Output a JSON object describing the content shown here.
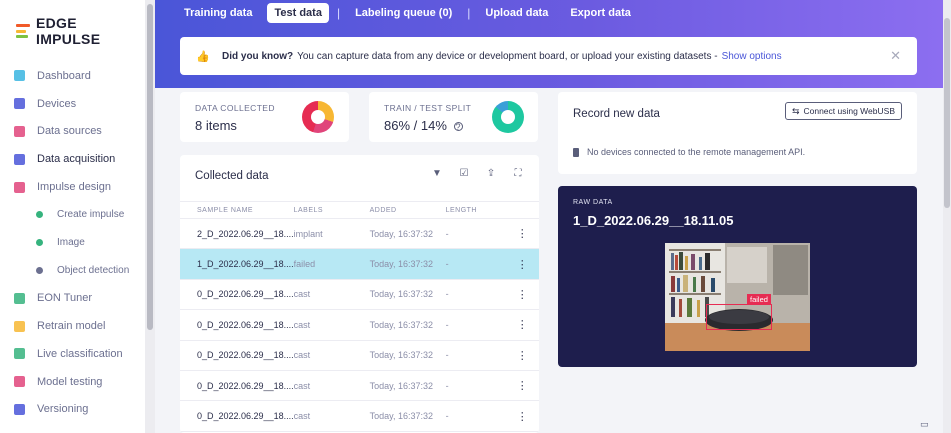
{
  "brand": {
    "name": "EDGE IMPULSE",
    "colors": [
      "#f15a29",
      "#f7b733",
      "#7dc242",
      "#4a90e2"
    ]
  },
  "sidebar": {
    "items": [
      {
        "label": "Dashboard",
        "icon": "monitor-icon",
        "color": "#3ab5e0"
      },
      {
        "label": "Devices",
        "icon": "chip-icon",
        "color": "#4a56d8"
      },
      {
        "label": "Data sources",
        "icon": "tools-icon",
        "color": "#e0457b"
      },
      {
        "label": "Data acquisition",
        "icon": "database-icon",
        "color": "#4a56d8",
        "active": true
      },
      {
        "label": "Impulse design",
        "icon": "pulse-icon",
        "color": "#e0457b"
      },
      {
        "label": "Create impulse",
        "sub": true,
        "color": "#36b37e"
      },
      {
        "label": "Image",
        "sub": true,
        "color": "#36b37e"
      },
      {
        "label": "Object detection",
        "sub": true,
        "color": "#6c7090"
      },
      {
        "label": "EON Tuner",
        "icon": "tuner-icon",
        "color": "#36b37e"
      },
      {
        "label": "Retrain model",
        "icon": "shuffle-icon",
        "color": "#f7b733"
      },
      {
        "label": "Live classification",
        "icon": "live-icon",
        "color": "#36b37e"
      },
      {
        "label": "Model testing",
        "icon": "test-icon",
        "color": "#e0457b"
      },
      {
        "label": "Versioning",
        "icon": "branch-icon",
        "color": "#4a56d8"
      }
    ]
  },
  "header": {
    "tabs": [
      {
        "label": "Training data",
        "active": false
      },
      {
        "label": "Test data",
        "active": true
      },
      {
        "label": "Labeling queue (0)",
        "active": false
      },
      {
        "label": "Upload data",
        "active": false
      },
      {
        "label": "Export data",
        "active": false
      }
    ]
  },
  "tip": {
    "title": "Did you know?",
    "text": "You can capture data from any device or development board, or upload your existing datasets -",
    "link": "Show options"
  },
  "stats": {
    "collected": {
      "label": "DATA COLLECTED",
      "value": "8 items"
    },
    "split": {
      "label": "TRAIN / TEST SPLIT",
      "value": "86% / 14%",
      "train_fraction": 0.86
    }
  },
  "collected_data": {
    "title": "Collected data",
    "columns": [
      "SAMPLE NAME",
      "LABELS",
      "ADDED",
      "LENGTH"
    ],
    "rows": [
      {
        "name": "2_D_2022.06.29__18....",
        "label": "implant",
        "added": "Today, 16:37:32",
        "length": "-",
        "selected": false
      },
      {
        "name": "1_D_2022.06.29__18....",
        "label": "failed",
        "added": "Today, 16:37:32",
        "length": "-",
        "selected": true
      },
      {
        "name": "0_D_2022.06.29__18....",
        "label": "cast",
        "added": "Today, 16:37:32",
        "length": "-",
        "selected": false
      },
      {
        "name": "0_D_2022.06.29__18....",
        "label": "cast",
        "added": "Today, 16:37:32",
        "length": "-",
        "selected": false
      },
      {
        "name": "0_D_2022.06.29__18....",
        "label": "cast",
        "added": "Today, 16:37:32",
        "length": "-",
        "selected": false
      },
      {
        "name": "0_D_2022.06.29__18....",
        "label": "cast",
        "added": "Today, 16:37:32",
        "length": "-",
        "selected": false
      },
      {
        "name": "0_D_2022.06.29__18....",
        "label": "cast",
        "added": "Today, 16:37:32",
        "length": "-",
        "selected": false
      }
    ]
  },
  "record": {
    "title": "Record new data",
    "button": "Connect using WebUSB",
    "no_devices": "No devices connected to the remote management API."
  },
  "raw_data": {
    "label": "RAW DATA",
    "sample": "1_D_2022.06.29__18.11.05",
    "bbox_label": "failed"
  }
}
